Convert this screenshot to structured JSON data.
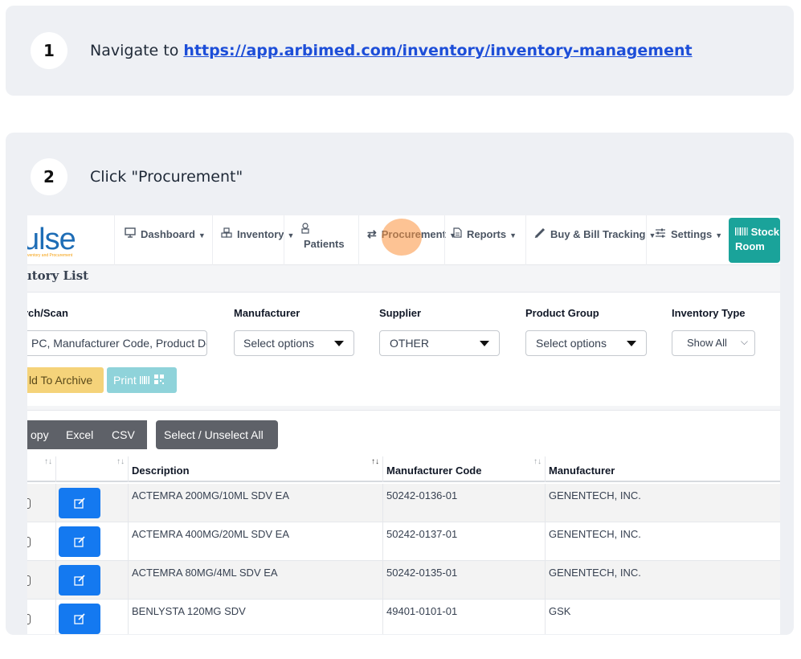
{
  "step1": {
    "number": "1",
    "text": "Navigate to ",
    "link": "https://app.arbimed.com/inventory/inventory-management"
  },
  "step2": {
    "number": "2",
    "text": "Click \"Procurement\""
  },
  "app": {
    "logo": {
      "word": "ulse",
      "tagline": "ventory and Procurement"
    },
    "nav": {
      "dashboard": "Dashboard",
      "inventory": "Inventory",
      "patients": "Patients",
      "procurement": "Procurement",
      "reports": "Reports",
      "buybill": "Buy & Bill Tracking",
      "settings": "Settings",
      "stock_line1": "Stock",
      "stock_line2": "Room"
    },
    "page_title": "ıtory List",
    "filters": {
      "search_label": "rch/Scan",
      "search_placeholder": "PC, Manufacturer Code, Product De",
      "manufacturer_label": "Manufacturer",
      "manufacturer_value": "Select options",
      "supplier_label": "Supplier",
      "supplier_value": "OTHER",
      "product_group_label": "Product Group",
      "product_group_value": "Select options",
      "inventory_type_label": "Inventory Type",
      "inventory_type_value": "Show All",
      "archive_button": "ld To Archive",
      "print_button": "Print"
    },
    "table": {
      "buttons": {
        "copy": "opy",
        "excel": "Excel",
        "csv": "CSV",
        "select_all": "Select / Unselect All"
      },
      "columns": [
        "",
        "",
        "Description",
        "Manufacturer Code",
        "Manufacturer"
      ],
      "rows": [
        {
          "description": "ACTEMRA 200MG/10ML SDV EA",
          "code": "50242-0136-01",
          "manufacturer": "GENENTECH, INC."
        },
        {
          "description": "ACTEMRA 400MG/20ML SDV EA",
          "code": "50242-0137-01",
          "manufacturer": "GENENTECH, INC."
        },
        {
          "description": "ACTEMRA 80MG/4ML SDV EA",
          "code": "50242-0135-01",
          "manufacturer": "GENENTECH, INC."
        },
        {
          "description": "BENLYSTA 120MG SDV",
          "code": "49401-0101-01",
          "manufacturer": "GSK"
        }
      ]
    }
  },
  "colors": {
    "card_bg": "#eef0f4",
    "link": "#1d4ed8",
    "logo": "#1e6db6",
    "stock_room": "#1aa39a",
    "edit_button": "#1479f0",
    "highlight": "#fb923c"
  },
  "icons": [
    "monitor-icon",
    "boxes-icon",
    "patients-icon",
    "swap-icon",
    "document-icon",
    "syringe-icon",
    "sliders-icon",
    "barcode-icon",
    "qr-icon",
    "edit-icon",
    "sort-icon",
    "caret-down-icon"
  ]
}
